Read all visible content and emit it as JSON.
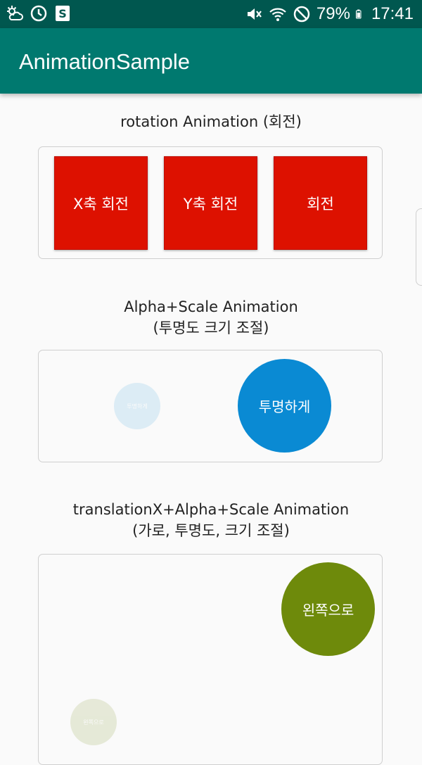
{
  "status_bar": {
    "battery": "79%",
    "time": "17:41",
    "left_icons": [
      "weather-icon",
      "sync-icon",
      "app-s-icon"
    ],
    "right_icons": [
      "mute-icon",
      "wifi-icon",
      "dnd-icon",
      "battery-icon"
    ]
  },
  "app_bar": {
    "title": "AnimationSample"
  },
  "sections": {
    "rotation": {
      "title": "rotation Animation (회전)",
      "buttons": [
        "X축 회전",
        "Y축 회전",
        "회전"
      ]
    },
    "alpha_scale": {
      "title_line1": "Alpha+Scale Animation",
      "title_line2": "(투명도 크기 조절)",
      "circle_label": "투명하게",
      "faded_label": "투명하게"
    },
    "translation": {
      "title_line1": "translationX+Alpha+Scale Animation",
      "title_line2": "(가로, 투명도, 크기 조절)",
      "circle_label": "왼쪽으로",
      "faded_label": "왼쪽으로"
    }
  },
  "colors": {
    "status_bar": "#00574f",
    "app_bar": "#00796f",
    "rotation_box": "#dd1100",
    "blue_circle": "#0a8ad3",
    "green_circle": "#6e8a0b"
  }
}
